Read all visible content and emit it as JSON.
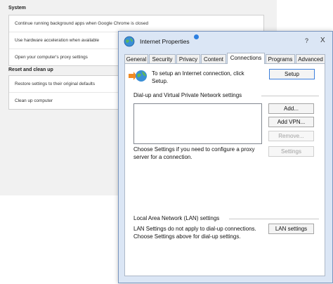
{
  "chrome": {
    "system_heading": "System",
    "system_items": [
      "Continue running background apps when Google Chrome is closed",
      "Use hardware acceleration when available",
      "Open your computer's proxy settings"
    ],
    "reset_heading": "Reset and clean up",
    "reset_items": [
      "Restore settings to their original defaults",
      "Clean up computer"
    ]
  },
  "dialog": {
    "title": "Internet Properties",
    "help": "?",
    "close": "X",
    "tabs": [
      "General",
      "Security",
      "Privacy",
      "Content",
      "Connections",
      "Programs",
      "Advanced"
    ],
    "active_tab": "Connections",
    "setup_text": "To setup an Internet connection, click Setup.",
    "setup_button": "Setup",
    "dialup_group": "Dial-up and Virtual Private Network settings",
    "add_button": "Add...",
    "add_vpn_button": "Add VPN...",
    "remove_button": "Remove...",
    "proxy_text": "Choose Settings if you need to configure a proxy server for a connection.",
    "settings_button": "Settings",
    "lan_group": "Local Area Network (LAN) settings",
    "lan_text": "LAN Settings do not apply to dial-up connections. Choose Settings above for dial-up settings.",
    "lan_button": "LAN settings"
  }
}
